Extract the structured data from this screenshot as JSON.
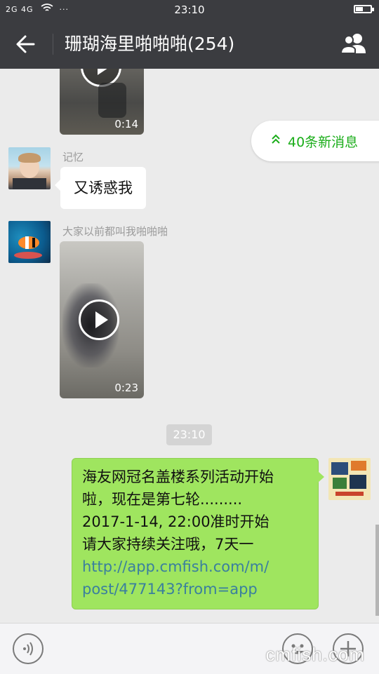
{
  "status": {
    "left": "2G 4G",
    "time": "23:10",
    "dots": "···"
  },
  "header": {
    "title": "珊瑚海里啪啪啪(254)"
  },
  "new_messages": {
    "label": "40条新消息"
  },
  "messages": [
    {
      "type": "video",
      "duration": "0:14"
    },
    {
      "type": "text",
      "sender": "记忆",
      "text": "又诱惑我"
    },
    {
      "type": "video",
      "sender": "大家以前都叫我啪啪啪",
      "duration": "0:23"
    },
    {
      "type": "timestamp",
      "text": "23:10"
    },
    {
      "type": "outgoing",
      "lines": [
        "海友网冠名盖楼系列活动开始",
        "啦，现在是第七轮.........",
        "2017-1-14, 22:00准时开始",
        "请大家持续关注哦，7天一"
      ],
      "link_lines": [
        "http://app.cmfish.com/m/",
        "post/477143?from=app"
      ]
    }
  ],
  "watermark": "cmfish.com",
  "colors": {
    "bar": "#3b3c40",
    "green_bubble": "#9fe55f",
    "accent": "#1aad19"
  }
}
